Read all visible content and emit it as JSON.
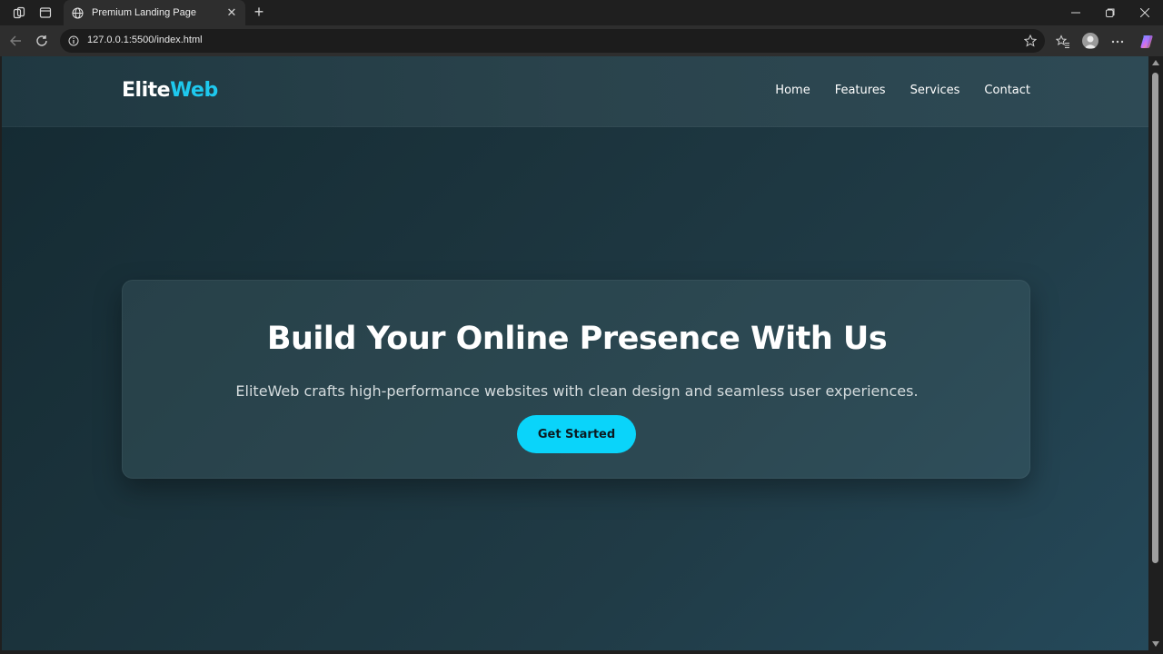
{
  "browser": {
    "tab_title": "Premium Landing Page",
    "url": "127.0.0.1:5500/index.html",
    "icons": [
      "workspaces-icon",
      "tab-actions-icon",
      "globe-icon",
      "close-icon",
      "plus-icon",
      "minimize-icon",
      "restore-icon",
      "close-window-icon",
      "back-icon",
      "refresh-icon",
      "info-icon",
      "star-icon",
      "favorites-icon",
      "profile-icon",
      "more-icon",
      "copilot-icon"
    ]
  },
  "site": {
    "logo_part1": "Elite",
    "logo_part2": "Web",
    "nav": [
      {
        "label": "Home"
      },
      {
        "label": "Features"
      },
      {
        "label": "Services"
      },
      {
        "label": "Contact"
      }
    ],
    "hero": {
      "title": "Build Your Online Presence With Us",
      "subtitle": "EliteWeb crafts high-performance websites with clean design and seamless user experiences.",
      "cta_label": "Get Started"
    },
    "colors": {
      "accent": "#0ad4fa",
      "logo_accent": "#1ec8ee",
      "background_dark": "#142a32",
      "background_light": "#25495a"
    }
  }
}
